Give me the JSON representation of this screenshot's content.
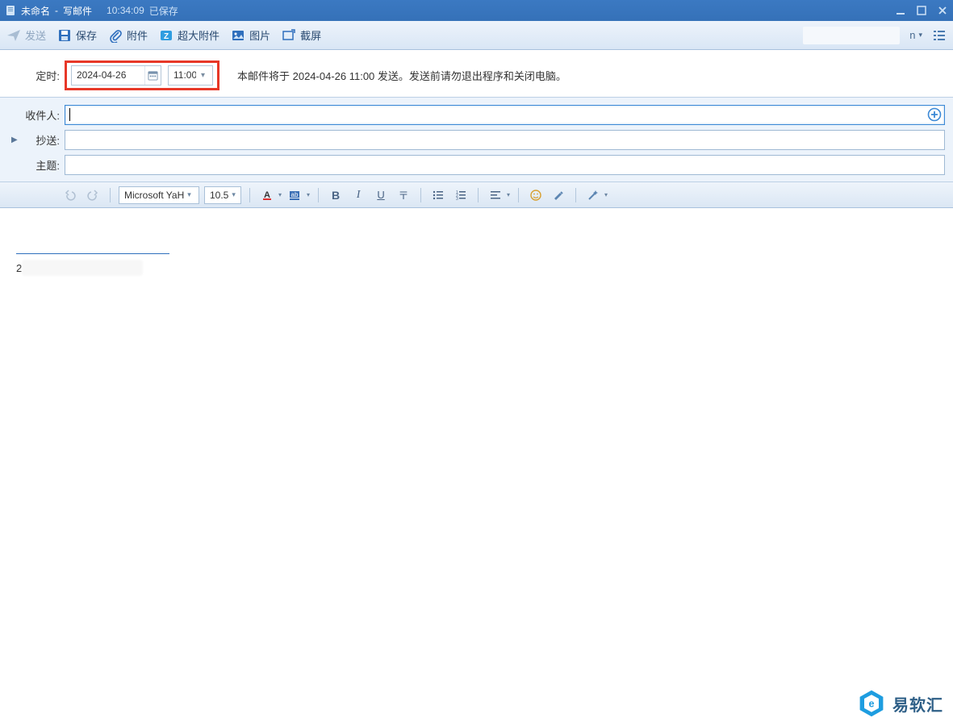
{
  "titlebar": {
    "doc": "未命名",
    "mode": "写邮件",
    "time": "10:34:09",
    "saved": "已保存"
  },
  "toolbar": {
    "send": "发送",
    "save": "保存",
    "attach": "附件",
    "bigattach": "超大附件",
    "image": "图片",
    "screenshot": "截屏",
    "right_dd": "n"
  },
  "schedule": {
    "label": "定时:",
    "date": "2024-04-26",
    "time": "11:00",
    "hint": "本邮件将于 2024-04-26 11:00 发送。发送前请勿退出程序和关闭电脑。"
  },
  "fields": {
    "to_label": "收件人:",
    "cc_label": "抄送:",
    "subject_label": "主题:",
    "to_value": "",
    "cc_value": "",
    "subject_value": ""
  },
  "editor": {
    "font": "Microsoft YaH",
    "size": "10.5"
  },
  "signature": {
    "prefix": "2"
  },
  "watermark": {
    "text": "易软汇"
  }
}
